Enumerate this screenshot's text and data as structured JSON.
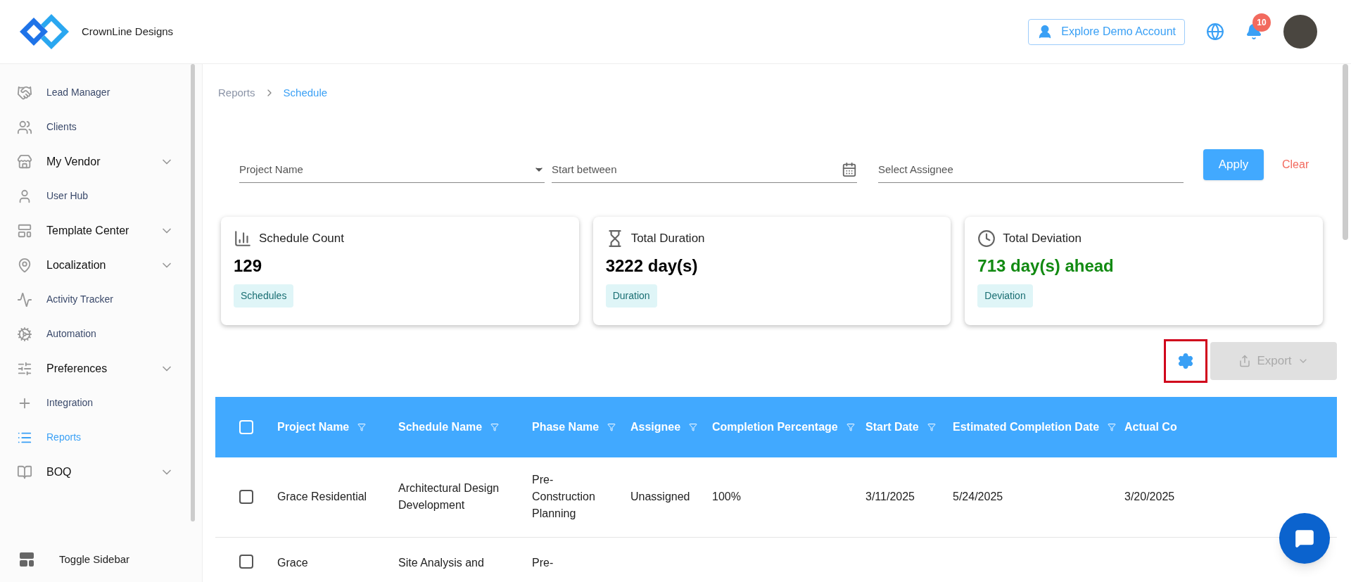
{
  "brand": {
    "name": "CrownLine Designs"
  },
  "header": {
    "demo_button": "Explore Demo Account",
    "notification_count": "10"
  },
  "sidebar": {
    "items": [
      {
        "label": "Lead Manager",
        "expandable": false,
        "selected": false
      },
      {
        "label": "Clients",
        "expandable": false,
        "selected": false
      },
      {
        "label": "My Vendor",
        "expandable": true,
        "selected": false
      },
      {
        "label": "User Hub",
        "expandable": false,
        "selected": false
      },
      {
        "label": "Template Center",
        "expandable": true,
        "selected": false
      },
      {
        "label": "Localization",
        "expandable": true,
        "selected": false
      },
      {
        "label": "Activity Tracker",
        "expandable": false,
        "selected": false
      },
      {
        "label": "Automation",
        "expandable": false,
        "selected": false
      },
      {
        "label": "Preferences",
        "expandable": true,
        "selected": false
      },
      {
        "label": "Integration",
        "expandable": false,
        "selected": false
      },
      {
        "label": "Reports",
        "expandable": false,
        "selected": true
      },
      {
        "label": "BOQ",
        "expandable": true,
        "selected": false
      }
    ],
    "toggle": "Toggle Sidebar"
  },
  "breadcrumb": [
    "Reports",
    "Schedule"
  ],
  "filters": {
    "project": {
      "placeholder": "Project Name"
    },
    "start": {
      "placeholder": "Start between"
    },
    "assignee": {
      "placeholder": "Select Assignee"
    },
    "apply": "Apply",
    "clear": "Clear"
  },
  "cards": [
    {
      "title": "Schedule Count",
      "value": "129",
      "tag": "Schedules",
      "color": "#000000"
    },
    {
      "title": "Total Duration",
      "value": "3222 day(s)",
      "tag": "Duration",
      "color": "#000000"
    },
    {
      "title": "Total Deviation",
      "value": "713 day(s) ahead",
      "tag": "Deviation",
      "color": "#128a12"
    }
  ],
  "toolbar": {
    "export": "Export",
    "export_disabled": true
  },
  "table": {
    "columns": [
      "Project Name",
      "Schedule Name",
      "Phase Name",
      "Assignee",
      "Completion Percentage",
      "Start Date",
      "Estimated Completion Date",
      "Actual Co"
    ],
    "rows": [
      {
        "checked": false,
        "cells": [
          "Grace Residential",
          "Architectural Design Development",
          "Pre-Construction Planning",
          "Unassigned",
          "100%",
          "3/11/2025",
          "5/24/2025",
          "3/20/2025"
        ]
      },
      {
        "checked": false,
        "cells": [
          "Grace",
          "Site Analysis and",
          "Pre-"
        ]
      }
    ],
    "select_all": false
  }
}
